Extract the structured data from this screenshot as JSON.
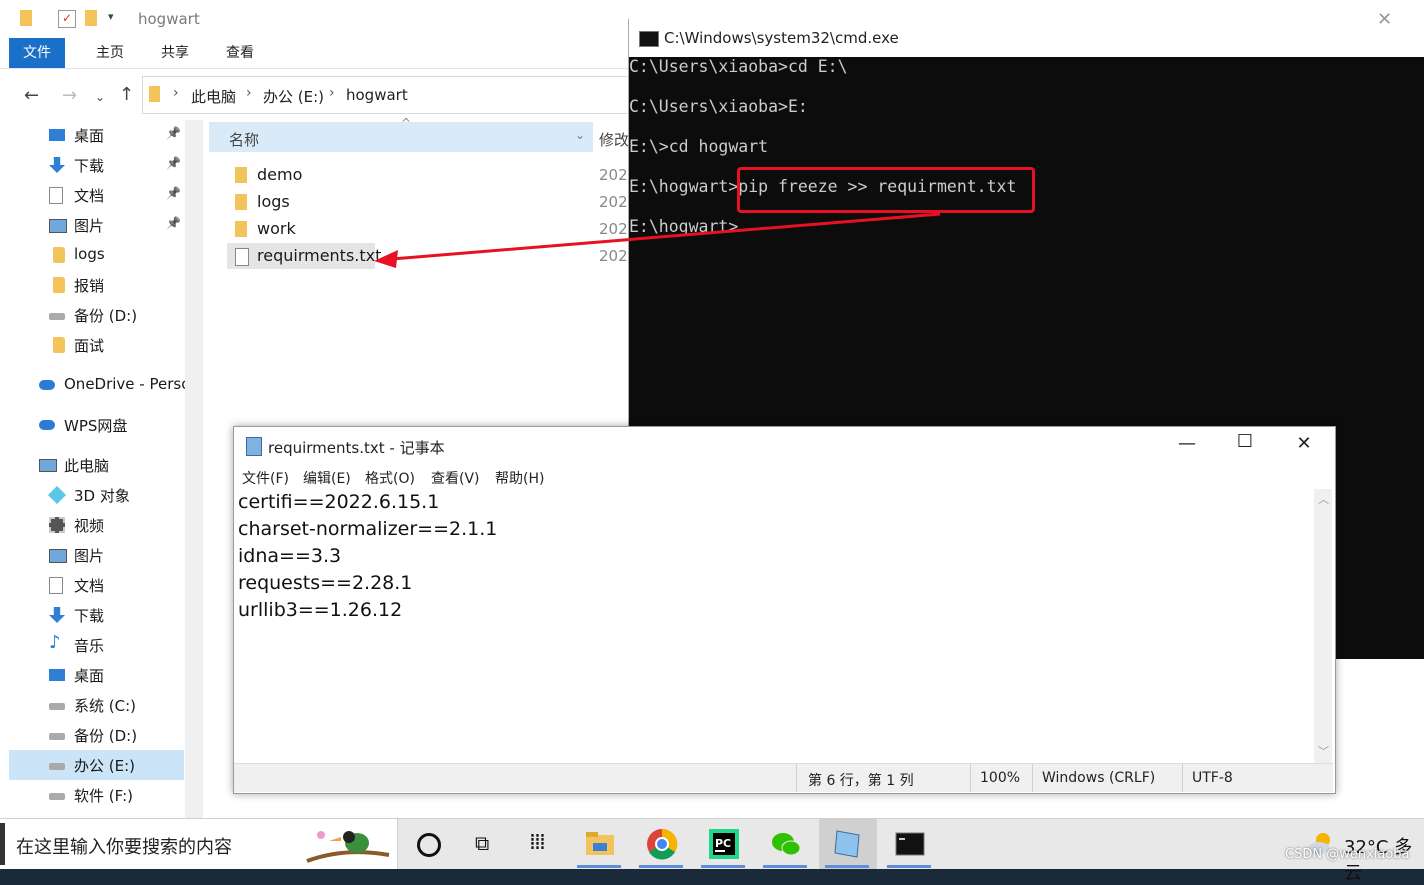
{
  "explorer": {
    "title": "hogwart",
    "ribbon_tabs": [
      "文件",
      "主页",
      "共享",
      "查看"
    ],
    "breadcrumb": [
      "此电脑",
      "办公 (E:)",
      "hogwart"
    ],
    "nav_items": [
      {
        "label": "桌面",
        "icon": "desktop-icon",
        "pinned": true
      },
      {
        "label": "下载",
        "icon": "download-icon",
        "pinned": true
      },
      {
        "label": "文档",
        "icon": "document-icon",
        "pinned": true
      },
      {
        "label": "图片",
        "icon": "picture-icon",
        "pinned": true
      },
      {
        "label": "logs",
        "icon": "folder-icon",
        "pinned": false
      },
      {
        "label": "报销",
        "icon": "folder-icon",
        "pinned": false
      },
      {
        "label": "备份 (D:)",
        "icon": "drive-icon",
        "pinned": false
      },
      {
        "label": "面试",
        "icon": "folder-icon",
        "pinned": false
      },
      {
        "label": "OneDrive - Perso",
        "icon": "onedrive-icon",
        "pinned": false
      },
      {
        "label": "WPS网盘",
        "icon": "wps-cloud-icon",
        "pinned": false
      },
      {
        "label": "此电脑",
        "icon": "computer-icon",
        "pinned": false
      },
      {
        "label": "3D 对象",
        "icon": "3d-objects-icon",
        "pinned": false
      },
      {
        "label": "视频",
        "icon": "video-icon",
        "pinned": false
      },
      {
        "label": "图片",
        "icon": "picture-icon",
        "pinned": false
      },
      {
        "label": "文档",
        "icon": "document-icon",
        "pinned": false
      },
      {
        "label": "下载",
        "icon": "download-icon",
        "pinned": false
      },
      {
        "label": "音乐",
        "icon": "music-icon",
        "pinned": false
      },
      {
        "label": "桌面",
        "icon": "desktop-icon",
        "pinned": false
      },
      {
        "label": "系统 (C:)",
        "icon": "drive-icon",
        "pinned": false
      },
      {
        "label": "备份 (D:)",
        "icon": "drive-icon",
        "pinned": false
      },
      {
        "label": "办公 (E:)",
        "icon": "drive-icon",
        "pinned": false,
        "selected": true
      },
      {
        "label": "软件 (F:)",
        "icon": "drive-icon",
        "pinned": false
      }
    ],
    "columns": {
      "name": "名称",
      "modified": "修改"
    },
    "files": [
      {
        "name": "demo",
        "date": "202",
        "type": "folder"
      },
      {
        "name": "logs",
        "date": "202",
        "type": "folder"
      },
      {
        "name": "work",
        "date": "202",
        "type": "folder"
      },
      {
        "name": "requirments.txt",
        "date": "202",
        "type": "txt",
        "selected": true
      }
    ]
  },
  "cmd": {
    "title": "C:\\Windows\\system32\\cmd.exe",
    "lines": [
      "C:\\Users\\xiaoba>cd E:\\",
      "",
      "C:\\Users\\xiaoba>E:",
      "",
      "E:\\>cd hogwart",
      "",
      "E:\\hogwart>pip freeze >> requirment.txt",
      "",
      "E:\\hogwart>"
    ],
    "highlight_color": "#e81123"
  },
  "notepad": {
    "title": "requirments.txt - 记事本",
    "menu": [
      "文件(F)",
      "编辑(E)",
      "格式(O)",
      "查看(V)",
      "帮助(H)"
    ],
    "content_lines": [
      "certifi==2022.6.15.1",
      "charset-normalizer==2.1.1",
      "idna==3.3",
      "requests==2.28.1",
      "urllib3==1.26.12"
    ],
    "status": {
      "position": "第 6 行，第 1 列",
      "zoom": "100%",
      "line_ending": "Windows (CRLF)",
      "encoding": "UTF-8"
    }
  },
  "taskbar": {
    "search_placeholder": "在这里输入你要搜索的内容",
    "weather": "32°C  多云",
    "apps": [
      "cortana-icon",
      "task-view-icon",
      "app-grid-icon",
      "file-explorer-icon",
      "chrome-icon",
      "pycharm-icon",
      "wechat-icon",
      "notepad-icon",
      "cmd-icon"
    ]
  },
  "watermark": "CSDN @wenxiaoba",
  "colors": {
    "accent": "#1a6fc8",
    "annotation_red": "#e81123"
  }
}
